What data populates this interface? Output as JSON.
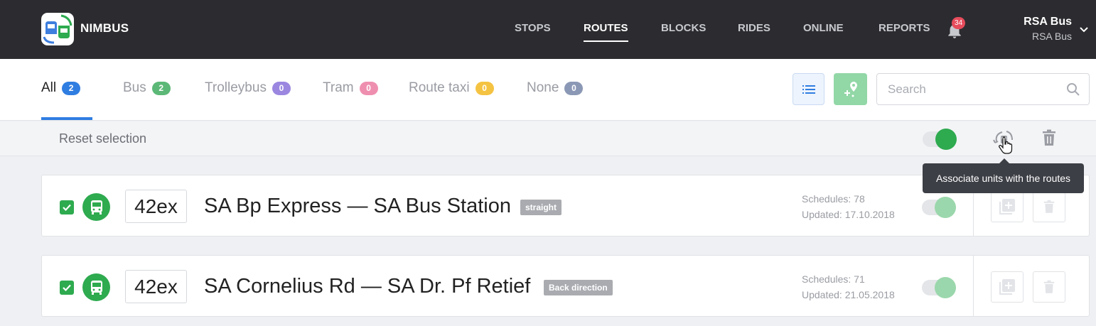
{
  "app": {
    "brand": "NIMBUS",
    "logo_icon": "transit-logo-icon"
  },
  "nav": {
    "items": [
      {
        "label": "STOPS",
        "active": false
      },
      {
        "label": "ROUTES",
        "active": true
      },
      {
        "label": "BLOCKS",
        "active": false
      },
      {
        "label": "RIDES",
        "active": false
      },
      {
        "label": "ONLINE",
        "active": false
      },
      {
        "label": "REPORTS",
        "active": false
      }
    ],
    "notifications": "34",
    "user": {
      "name": "RSA Bus",
      "company": "RSA Bus"
    }
  },
  "tabs": [
    {
      "label": "All",
      "count": "2",
      "color": "#2f7de1",
      "active": true
    },
    {
      "label": "Bus",
      "count": "2",
      "color": "#5cb877",
      "active": false
    },
    {
      "label": "Trolleybus",
      "count": "0",
      "color": "#9b87e0",
      "active": false
    },
    {
      "label": "Tram",
      "count": "0",
      "color": "#ef8fb0",
      "active": false
    },
    {
      "label": "Route taxi",
      "count": "0",
      "color": "#f5c342",
      "active": false
    },
    {
      "label": "None",
      "count": "0",
      "color": "#8b98b5",
      "active": false
    }
  ],
  "search": {
    "placeholder": "Search",
    "value": ""
  },
  "selection": {
    "reset_label": "Reset selection"
  },
  "tooltip": "Associate units with the routes",
  "colors": {
    "accent": "#2f7de1",
    "green": "#2eaa4f",
    "topbar": "#2c2c30"
  },
  "routes": [
    {
      "number": "42ex",
      "name": "SA Bp Express — SA Bus Station",
      "direction": "straight",
      "schedules": "Schedules: 78",
      "updated": "Updated: 17.10.2018",
      "checked": true,
      "enabled": true
    },
    {
      "number": "42ex",
      "name": "SA Cornelius Rd — SA Dr. Pf Retief",
      "direction": "Back direction",
      "schedules": "Schedules: 71",
      "updated": "Updated: 21.05.2018",
      "checked": true,
      "enabled": true
    }
  ]
}
